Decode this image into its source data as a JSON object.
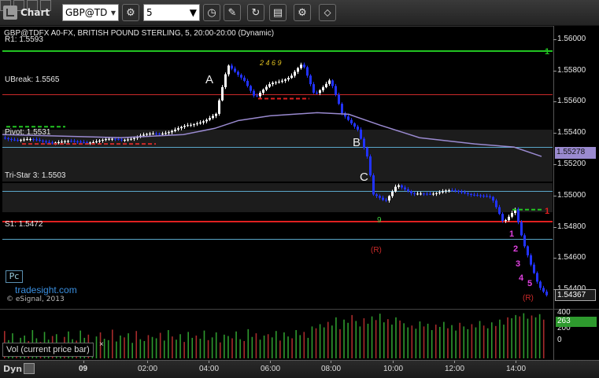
{
  "toolbar": {
    "app_title": "Chart",
    "symbol": "GBP@TD",
    "interval": "5",
    "icons": [
      "chart-app-icon",
      "symbol-dropdown-icon",
      "settings-gear-icon",
      "interval-dropdown-icon",
      "clock-icon",
      "draw-pencil-icon",
      "refresh-icon",
      "export-icon",
      "link-icon"
    ]
  },
  "chart": {
    "header": "GBP@TDFX A0-FX, BRITISH POUND STERLING, 5, 20:00-20:00 (Dynamic)",
    "levels": [
      {
        "name": "R1",
        "label": "R1: 1.5593",
        "price": 1.5593,
        "color": "#22c422"
      },
      {
        "name": "UBreak",
        "label": "UBreak: 1.5565",
        "price": 1.5565,
        "color": "#cc2a2a"
      },
      {
        "name": "Pivot",
        "label": "Pivot: 1.5531",
        "price": 1.5531,
        "color": "#5aa6c8"
      },
      {
        "name": "Tri-Star 3",
        "label": "Tri-Star 3: 1.5503",
        "price": 1.5503,
        "color": "#5aa6c8"
      },
      {
        "name": "LBreak",
        "label": "",
        "price": 1.5484,
        "color": "#e02020"
      },
      {
        "name": "S1",
        "label": "S1: 1.5472",
        "price": 1.5472,
        "color": "#5aa6c8"
      }
    ],
    "side_counts": [
      {
        "level": "R1",
        "value": "1"
      },
      {
        "level": "LBreak",
        "value": "1"
      }
    ],
    "point_letters": [
      "A",
      "B",
      "C"
    ],
    "annotations": {
      "red_r": "(R)",
      "green_count": "9",
      "yellow_setup": "2 4 6 9"
    },
    "current_price": "1.54367",
    "ma_value": "1.55278",
    "pc_button": "Pc",
    "brand": "tradesight.com",
    "copyright": "© eSignal, 2013"
  },
  "colors": {
    "up_bar": "#ffffff",
    "down_bar": "#2233ff",
    "ma": "#9a8ad0",
    "price_tag_bg": "#2a2a2a",
    "ma_tag_bg": "#9a8ad0",
    "vol_up": "#2e9a2e",
    "vol_down": "#a82b2b"
  },
  "volume": {
    "label": "Vol (current price bar)",
    "axis_ticks": [
      "400",
      "200",
      "0"
    ],
    "current": "263",
    "bars": [
      60,
      40,
      55,
      30,
      45,
      50,
      38,
      62,
      44,
      36,
      58,
      41,
      49,
      53,
      33,
      47,
      59,
      42,
      39,
      61,
      45,
      52,
      35,
      48,
      57,
      43,
      40,
      63,
      37,
      50,
      46,
      55,
      34,
      60,
      42,
      38,
      51,
      47,
      44,
      56,
      39,
      62,
      48,
      41,
      53,
      36,
      58,
      45,
      50,
      43,
      61,
      40,
      46,
      57,
      35,
      52,
      49,
      44,
      59,
      42,
      38,
      64,
      47,
      55,
      41,
      50,
      53,
      46,
      60,
      39,
      57,
      48,
      44,
      62,
      51,
      58,
      45,
      70,
      66,
      75,
      68,
      80,
      72,
      90,
      64,
      85,
      78,
      95,
      82,
      70,
      88,
      76,
      92,
      84,
      98,
      79,
      86,
      74,
      90,
      83,
      77,
      68,
      72,
      65,
      81,
      70,
      76,
      62,
      74,
      69,
      80,
      66,
      73,
      61,
      78,
      70,
      64,
      75,
      68,
      82,
      72,
      66,
      79,
      71,
      85,
      74,
      90,
      88,
      95,
      92,
      99,
      87,
      94,
      90,
      97,
      85
    ]
  },
  "x_axis": {
    "ticks": [
      "09",
      "02:00",
      "04:00",
      "06:00",
      "08:00",
      "10:00",
      "12:00",
      "14:00"
    ]
  },
  "y_axis": {
    "min": 1.5428,
    "max": 1.5608,
    "ticks": [
      "1.56000",
      "1.55800",
      "1.55600",
      "1.55400",
      "1.55200",
      "1.55000",
      "1.54800",
      "1.54600",
      "1.54400"
    ]
  },
  "bottom": {
    "tab": "Dyn"
  }
}
